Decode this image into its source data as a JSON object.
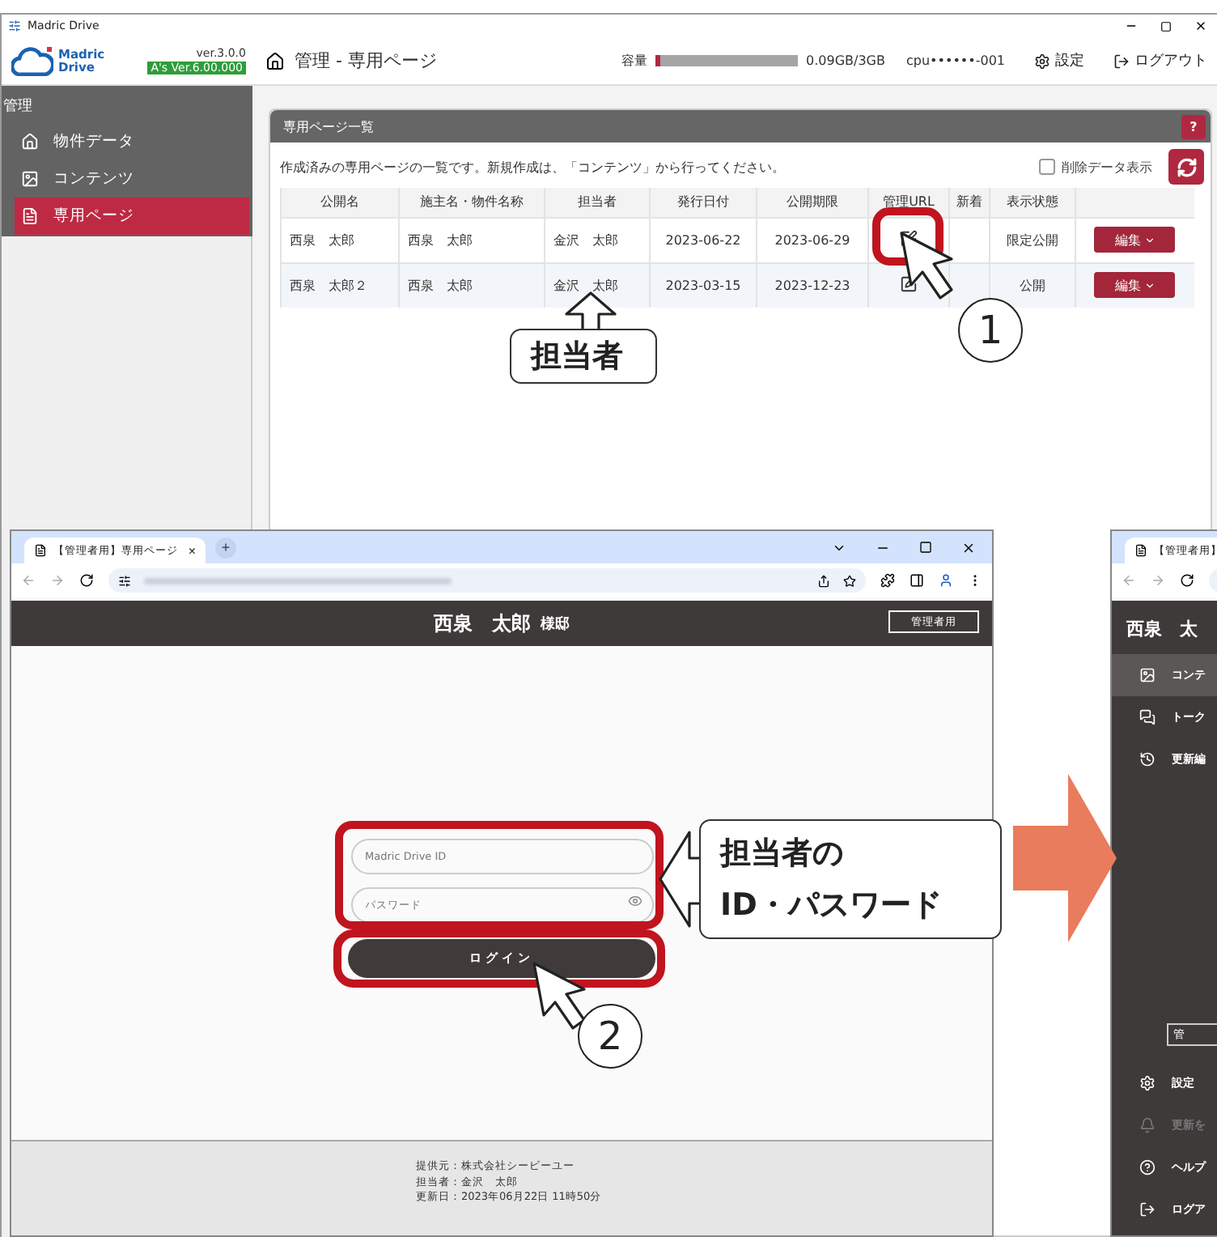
{
  "main_window": {
    "title": "Madric Drive",
    "logo": [
      "Madric",
      "Drive"
    ],
    "version": "ver.3.0.0",
    "as_version": "A's Ver.6.00.000",
    "page_title": "管理 - 専用ページ",
    "capacity": {
      "label": "容量",
      "level": 0.03,
      "reading": "0.09GB/3GB"
    },
    "account": "cpu••••••-001",
    "actions": [
      {
        "kind": "settings",
        "label": "設定"
      },
      {
        "kind": "logout",
        "label": "ログアウト"
      }
    ],
    "sidebar": {
      "heading": "管理",
      "items": [
        {
          "kind": "home",
          "label": "物件データ",
          "selected": false
        },
        {
          "kind": "image",
          "label": "コンテンツ",
          "selected": false
        },
        {
          "kind": "page",
          "label": "専用ページ",
          "selected": true
        }
      ]
    },
    "panel": {
      "title": "専用ページ一覧",
      "help": "?",
      "description": "作成済みの専用ページの一覧です。新規作成は、「コンテンツ」から行ってください。",
      "show_deleted": {
        "label": "削除データ表示",
        "checked": false
      },
      "table": {
        "columns": [
          "公開名",
          "施主名・物件名称",
          "担当者",
          "発行日付",
          "公開期限",
          "管理URL",
          "新着",
          "表示状態"
        ],
        "rows": [
          {
            "cells": [
              "西泉　太郎",
              "西泉　太郎",
              "金沢　太郎",
              "2023-06-22",
              "2023-06-29"
            ],
            "status": "限定公開",
            "action": "編集"
          },
          {
            "cells": [
              "西泉　太郎２",
              "西泉　太郎",
              "金沢　太郎",
              "2023-03-15",
              "2023-12-23"
            ],
            "status": "公開",
            "action": "編集"
          }
        ]
      }
    }
  },
  "browser_login": {
    "tab": {
      "title": "【管理者用】専用ページ",
      "close": "×",
      "new": "+"
    },
    "header": {
      "name": "西泉　太郎",
      "suffix": "様邸",
      "admin_button": "管理者用"
    },
    "login": {
      "id_placeholder": "Madric Drive ID",
      "password_placeholder": "パスワード",
      "button": "ログイン"
    },
    "footer": [
      "提供元：株式会社シーピーユー",
      "担当者：金沢　太郎",
      "更新日：2023年06月22日 11時50分"
    ]
  },
  "browser_admin": {
    "tab_title": "【管理者用】",
    "header": "西泉　太",
    "menu": [
      {
        "kind": "image",
        "label": "コンテ",
        "selected": true
      },
      {
        "kind": "chat",
        "label": "トーク",
        "selected": false
      },
      {
        "kind": "history",
        "label": "更新編",
        "selected": false
      }
    ],
    "button": "管",
    "bottom_menu": [
      {
        "kind": "settings",
        "label": "設定",
        "disabled": false
      },
      {
        "kind": "bell",
        "label": "更新を",
        "disabled": true
      },
      {
        "kind": "help",
        "label": "ヘルプ",
        "disabled": false
      },
      {
        "kind": "logout",
        "label": "ログア",
        "disabled": false
      }
    ]
  },
  "annotations": {
    "staff_callout": "担当者",
    "step_1": "1",
    "credentials_callout": [
      "担当者の",
      "ID・パスワード"
    ],
    "step_2": "2"
  }
}
